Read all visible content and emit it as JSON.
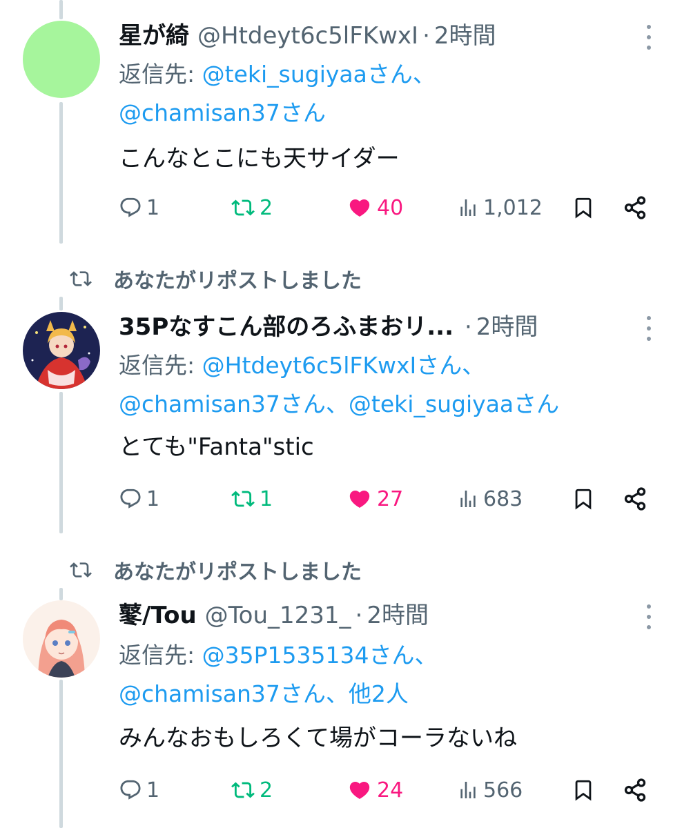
{
  "tweets": [
    {
      "name": "星が綺",
      "handle": "@Htdeyt6c5lFKwxI",
      "time": "2時間",
      "reply_prefix": "返信先:",
      "reply_line1": "@teki_sugiyaaさん、",
      "reply_line2": "@chamisan37さん",
      "text": "こんなとこにも天サイダー",
      "replies": "1",
      "reposts": "2",
      "likes": "40",
      "views": "1,012",
      "avatar_color": "#a6f59c"
    },
    {
      "repost_label": "あなたがリポストしました",
      "name": "35Pなすこん部のろふまおリ...",
      "time": "2時間",
      "reply_prefix": "返信先:",
      "reply_line1": "@Htdeyt6c5lFKwxIさん、",
      "reply_line2a": "@chamisan37さん、",
      "reply_line2b": "@teki_sugiyaaさん",
      "text": "とても\"Fanta\"stic",
      "replies": "1",
      "reposts": "1",
      "likes": "27",
      "views": "683"
    },
    {
      "repost_label": "あなたがリポストしました",
      "name": "鼕/Tou",
      "handle": "@Tou_1231_",
      "time": "2時間",
      "reply_prefix": "返信先:",
      "reply_line1": "@35P1535134さん、",
      "reply_line2a": "@chamisan37さん、",
      "reply_line2b": "他2人",
      "text": "みんなおもしろくて場がコーラないね",
      "replies": "1",
      "reposts": "2",
      "likes": "24",
      "views": "566"
    }
  ],
  "colors": {
    "accent": "#1d9bf0",
    "repost": "#00ba7c",
    "like": "#f91880",
    "muted": "#536471"
  },
  "icons": [
    "reply-icon",
    "repost-icon",
    "heart-icon",
    "views-icon",
    "bookmark-icon",
    "share-icon",
    "more-icon"
  ]
}
